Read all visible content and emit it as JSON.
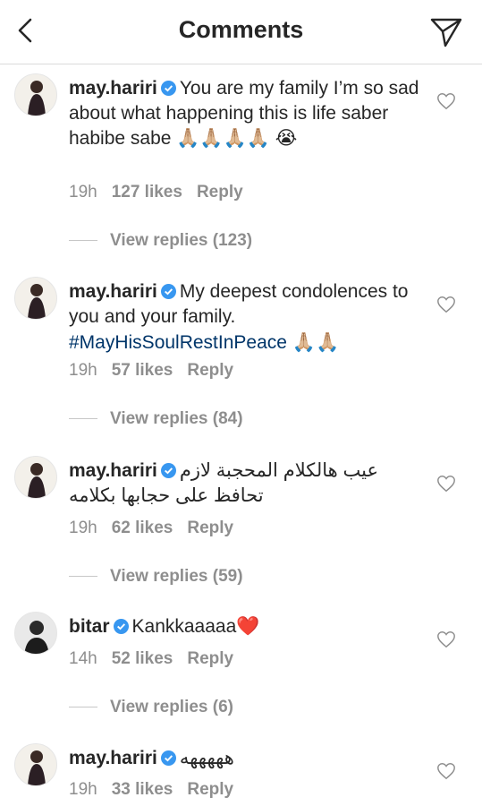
{
  "header": {
    "title": "Comments"
  },
  "comments": [
    {
      "username": "may.hariri",
      "text": "You are my family I’m so sad about what happening  this is life saber habibe sabe 🙏🏼🙏🏼🙏🏼🙏🏼 😭",
      "time": "19h",
      "likes": "127 likes",
      "reply": "Reply",
      "view_replies": "View replies (123)",
      "avatar_icon": "woman-avatar-icon"
    },
    {
      "username": "may.hariri",
      "text": "My deepest condolences to you and your family.",
      "hashtag": "#MayHisSoulRestInPeace",
      "emoji": "🙏🏼🙏🏼",
      "time": "19h",
      "likes": "57 likes",
      "reply": "Reply",
      "view_replies": "View replies (84)",
      "avatar_icon": "woman-avatar-icon"
    },
    {
      "username": "may.hariri",
      "text": "عيب هالكلام المحجبة لازم تحافظ على حجابها بكلامه",
      "time": "19h",
      "likes": "62 likes",
      "reply": "Reply",
      "view_replies": "View replies (59)",
      "avatar_icon": "woman-avatar-icon"
    },
    {
      "username": "bitar",
      "text": "Kankkaaaaa❤️",
      "time": "14h",
      "likes": "52 likes",
      "reply": "Reply",
      "view_replies": "View replies (6)",
      "avatar_icon": "man-avatar-icon"
    },
    {
      "username": "may.hariri",
      "text": "هههههه",
      "time": "19h",
      "likes": "33 likes",
      "reply": "Reply",
      "avatar_icon": "woman-avatar-icon"
    }
  ],
  "colors": {
    "verified": "#3897f0",
    "hashtag": "#003569",
    "muted": "#8e8e8e"
  }
}
